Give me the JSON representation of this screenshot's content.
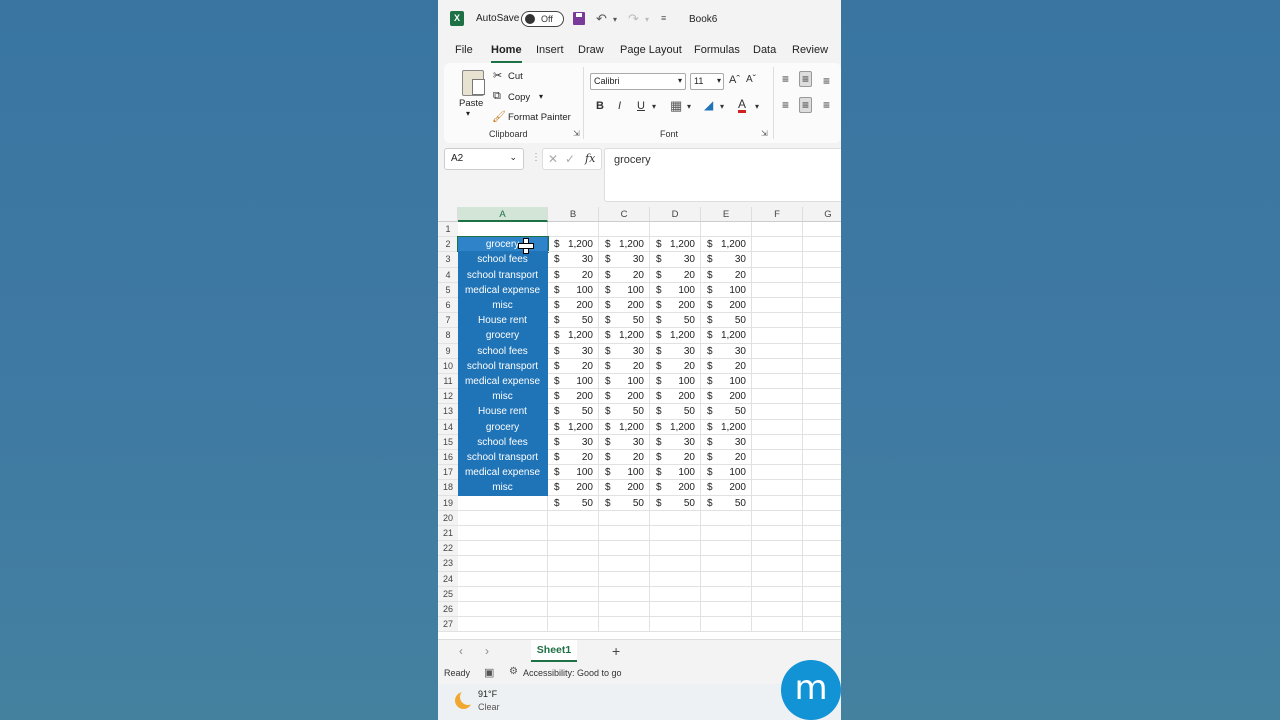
{
  "titlebar": {
    "autosave_label": "AutoSave",
    "toggle_state": "Off",
    "book_name": "Book6",
    "more_glyph": "≡"
  },
  "tabs": [
    {
      "label": "File"
    },
    {
      "label": "Home"
    },
    {
      "label": "Insert"
    },
    {
      "label": "Draw"
    },
    {
      "label": "Page Layout"
    },
    {
      "label": "Formulas"
    },
    {
      "label": "Data"
    },
    {
      "label": "Review"
    }
  ],
  "ribbon": {
    "paste": "Paste",
    "cut": "Cut",
    "copy": "Copy",
    "format_painter": "Format Painter",
    "clipboard_group": "Clipboard",
    "font_name": "Calibri",
    "font_size": "11",
    "font_group": "Font",
    "bold": "B",
    "italic": "I",
    "underline": "U"
  },
  "formula_bar": {
    "name_box": "A2",
    "fx": "fx",
    "content": "grocery"
  },
  "columns": [
    "A",
    "B",
    "C",
    "D",
    "E",
    "F",
    "G"
  ],
  "rows": [
    {
      "n": "1",
      "a": "",
      "v": ""
    },
    {
      "n": "2",
      "a": "grocery",
      "v": "1,200"
    },
    {
      "n": "3",
      "a": "school fees",
      "v": "30"
    },
    {
      "n": "4",
      "a": "school transport",
      "v": "20"
    },
    {
      "n": "5",
      "a": "medical expense",
      "v": "100"
    },
    {
      "n": "6",
      "a": "misc",
      "v": "200"
    },
    {
      "n": "7",
      "a": "House rent",
      "v": "50"
    },
    {
      "n": "8",
      "a": "grocery",
      "v": "1,200"
    },
    {
      "n": "9",
      "a": "school fees",
      "v": "30"
    },
    {
      "n": "10",
      "a": "school transport",
      "v": "20"
    },
    {
      "n": "11",
      "a": "medical expense",
      "v": "100"
    },
    {
      "n": "12",
      "a": "misc",
      "v": "200"
    },
    {
      "n": "13",
      "a": "House rent",
      "v": "50"
    },
    {
      "n": "14",
      "a": "grocery",
      "v": "1,200"
    },
    {
      "n": "15",
      "a": "school fees",
      "v": "30"
    },
    {
      "n": "16",
      "a": "school transport",
      "v": "20"
    },
    {
      "n": "17",
      "a": "medical expense",
      "v": "100"
    },
    {
      "n": "18",
      "a": "misc",
      "v": "200"
    },
    {
      "n": "19",
      "a": "",
      "v": "50"
    },
    {
      "n": "20",
      "a": "",
      "v": ""
    },
    {
      "n": "21",
      "a": "",
      "v": ""
    },
    {
      "n": "22",
      "a": "",
      "v": ""
    },
    {
      "n": "23",
      "a": "",
      "v": ""
    },
    {
      "n": "24",
      "a": "",
      "v": ""
    },
    {
      "n": "25",
      "a": "",
      "v": ""
    },
    {
      "n": "26",
      "a": "",
      "v": ""
    },
    {
      "n": "27",
      "a": "",
      "v": ""
    }
  ],
  "currency_symbol": "$",
  "sheet": {
    "name": "Sheet1",
    "add": "+"
  },
  "status": {
    "ready": "Ready",
    "accessibility": "Accessibility: Good to go"
  },
  "weather": {
    "temp": "91°F",
    "condition": "Clear"
  },
  "logo_letter": "m",
  "colors": {
    "excel_green": "#1e7145",
    "selection_blue": "#1f73b7",
    "bg": "#3f78a0"
  }
}
